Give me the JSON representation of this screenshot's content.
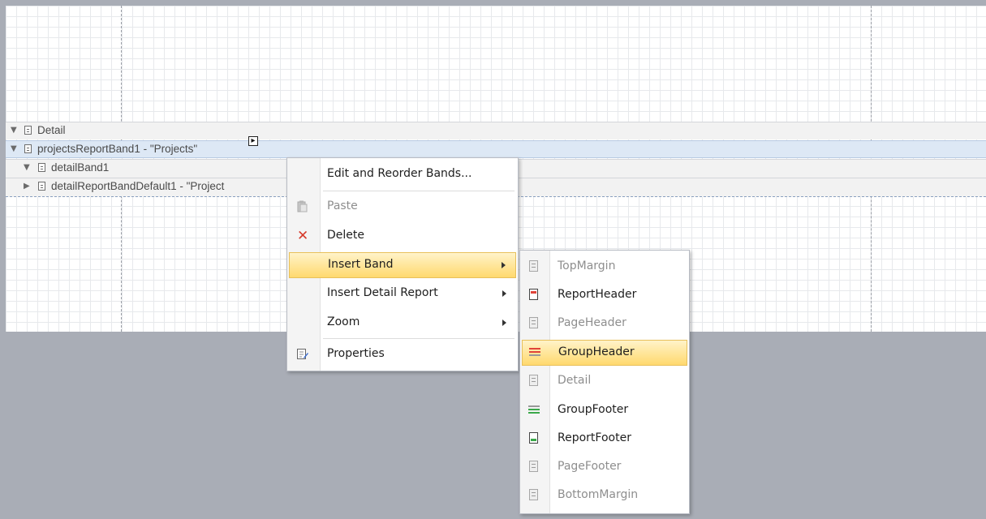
{
  "bands": [
    {
      "name": "Detail",
      "expanded": true,
      "selected": false
    },
    {
      "name": "projectsReportBand1 - \"Projects\"",
      "expanded": true,
      "selected": true
    },
    {
      "name": "detailBand1",
      "expanded": true,
      "selected": false
    },
    {
      "name": "detailReportBandDefault1 - \"Project",
      "expanded": false,
      "selected": false
    }
  ],
  "smart_tag": "▸",
  "context_menu": {
    "items": [
      {
        "label": "Edit and Reorder Bands...",
        "icon": null,
        "enabled": true
      },
      {
        "label": "Paste",
        "icon": "paste-icon",
        "enabled": false
      },
      {
        "label": "Delete",
        "icon": "delete-icon",
        "enabled": true
      },
      {
        "label": "Insert Band",
        "icon": null,
        "enabled": true,
        "submenu": true,
        "highlighted": true
      },
      {
        "label": "Insert Detail Report",
        "icon": null,
        "enabled": true,
        "submenu": true
      },
      {
        "label": "Zoom",
        "icon": null,
        "enabled": true,
        "submenu": true
      },
      {
        "label": "Properties",
        "icon": "properties-icon",
        "enabled": true
      }
    ]
  },
  "insert_band_submenu": {
    "items": [
      {
        "label": "TopMargin",
        "icon": "top-margin-band-icon",
        "enabled": false
      },
      {
        "label": "ReportHeader",
        "icon": "report-header-band-icon",
        "enabled": true
      },
      {
        "label": "PageHeader",
        "icon": "page-header-band-icon",
        "enabled": false
      },
      {
        "label": "GroupHeader",
        "icon": "group-header-band-icon",
        "enabled": true,
        "highlighted": true
      },
      {
        "label": "Detail",
        "icon": "detail-band-icon",
        "enabled": false
      },
      {
        "label": "GroupFooter",
        "icon": "group-footer-band-icon",
        "enabled": true
      },
      {
        "label": "ReportFooter",
        "icon": "report-footer-band-icon",
        "enabled": true
      },
      {
        "label": "PageFooter",
        "icon": "page-footer-band-icon",
        "enabled": false
      },
      {
        "label": "BottomMargin",
        "icon": "bottom-margin-band-icon",
        "enabled": false
      }
    ]
  },
  "colors": {
    "highlight_top": "#fff3c9",
    "highlight_bottom": "#ffd96e",
    "selected_band": "#dde8f5",
    "delete_red": "#d63a2b",
    "group_header_red": "#e0443a",
    "group_footer_green": "#3aa84a"
  }
}
